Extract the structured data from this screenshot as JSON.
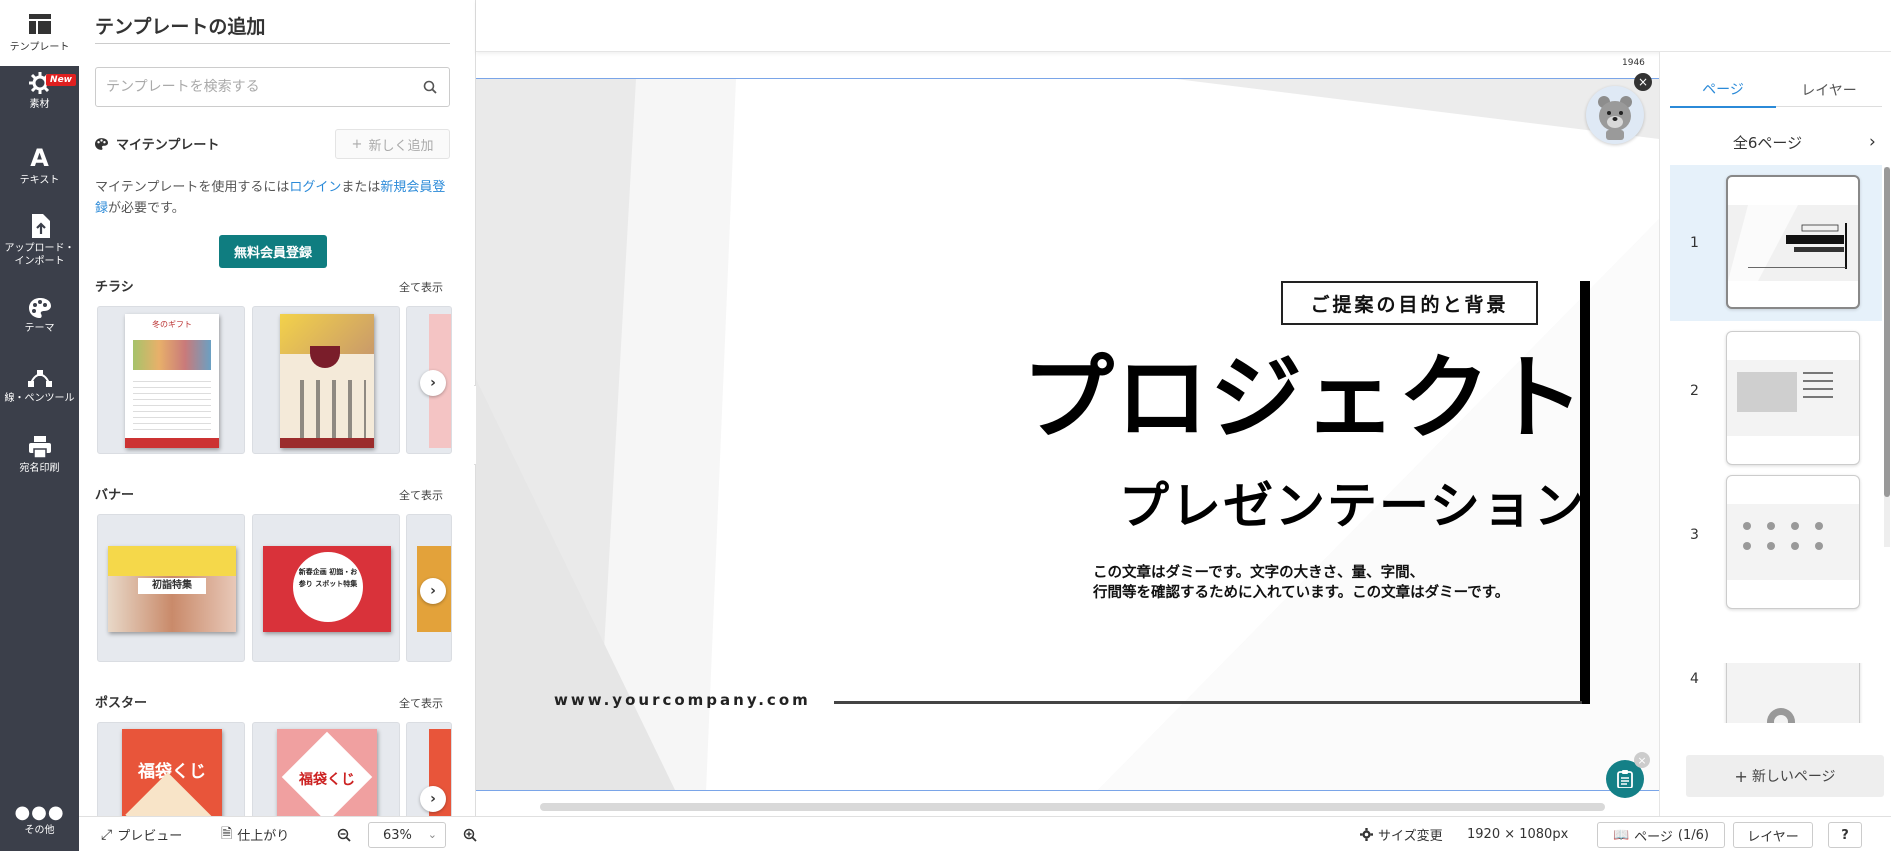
{
  "rail": {
    "items": [
      {
        "label": "テンプレート",
        "icon": "template-icon"
      },
      {
        "label": "素材",
        "icon": "gear-icon",
        "badge": "New"
      },
      {
        "label": "テキスト",
        "icon": "text-icon"
      },
      {
        "label": "アップロード・\nインポート",
        "icon": "upload-icon"
      },
      {
        "label": "テーマ",
        "icon": "palette-icon"
      },
      {
        "label": "線・ペンツール",
        "icon": "pen-tool-icon"
      },
      {
        "label": "宛名印刷",
        "icon": "printer-icon"
      },
      {
        "label": "その他",
        "icon": "more-icon"
      }
    ]
  },
  "panel": {
    "title": "テンプレートの追加",
    "search_placeholder": "テンプレートを検索する",
    "my_templates": {
      "title": "マイテンプレート",
      "add_label": "新しく追加",
      "note_prefix": "マイテンプレートを使用するには",
      "login_link": "ログイン",
      "note_or": "または",
      "register_link": "新規会員登録",
      "note_suffix": "が必要です。",
      "register_button": "無料会員登録"
    },
    "sections": [
      {
        "title": "チラシ",
        "show_all": "全て表示"
      },
      {
        "title": "バナー",
        "show_all": "全て表示"
      },
      {
        "title": "ポスター",
        "show_all": "全て表示"
      }
    ],
    "thumb_texts": {
      "flyer1": "冬のギフト",
      "banner1": "初詣特集",
      "banner2": "新春企画 初詣・お参り スポット特集",
      "poster1": "福袋くじ",
      "poster2": "福袋くじ"
    }
  },
  "slide": {
    "proposal": "ご提案の目的と背景",
    "title": "プロジェクト",
    "subtitle": "プレゼンテーション",
    "body_line1": "この文章はダミーです。文字の大きさ、量、字間、",
    "body_line2": "行間等を確認するために入れています。この文章はダミーです。",
    "url": "www.yourcompany.com",
    "ruler_label": "1946"
  },
  "right_panel": {
    "tabs": [
      "ページ",
      "レイヤー"
    ],
    "active_tab": "ページ",
    "page_count": "全6ページ",
    "pages": [
      "1",
      "2",
      "3",
      "4"
    ],
    "selected_page": "1",
    "new_page_label": "新しいページ"
  },
  "bottom_bar": {
    "preview": "プレビュー",
    "finish": "仕上がり",
    "zoom": "63%",
    "size_change": "サイズ変更",
    "dimensions": "1920 × 1080px",
    "page_label": "ページ",
    "page_indicator": "(1/6)",
    "layer": "レイヤー",
    "help": "?"
  },
  "colors": {
    "rail_bg": "#3b3f4a",
    "accent_teal": "#0f7d80",
    "link_blue": "#2b8ad8",
    "new_badge": "#e02020"
  }
}
